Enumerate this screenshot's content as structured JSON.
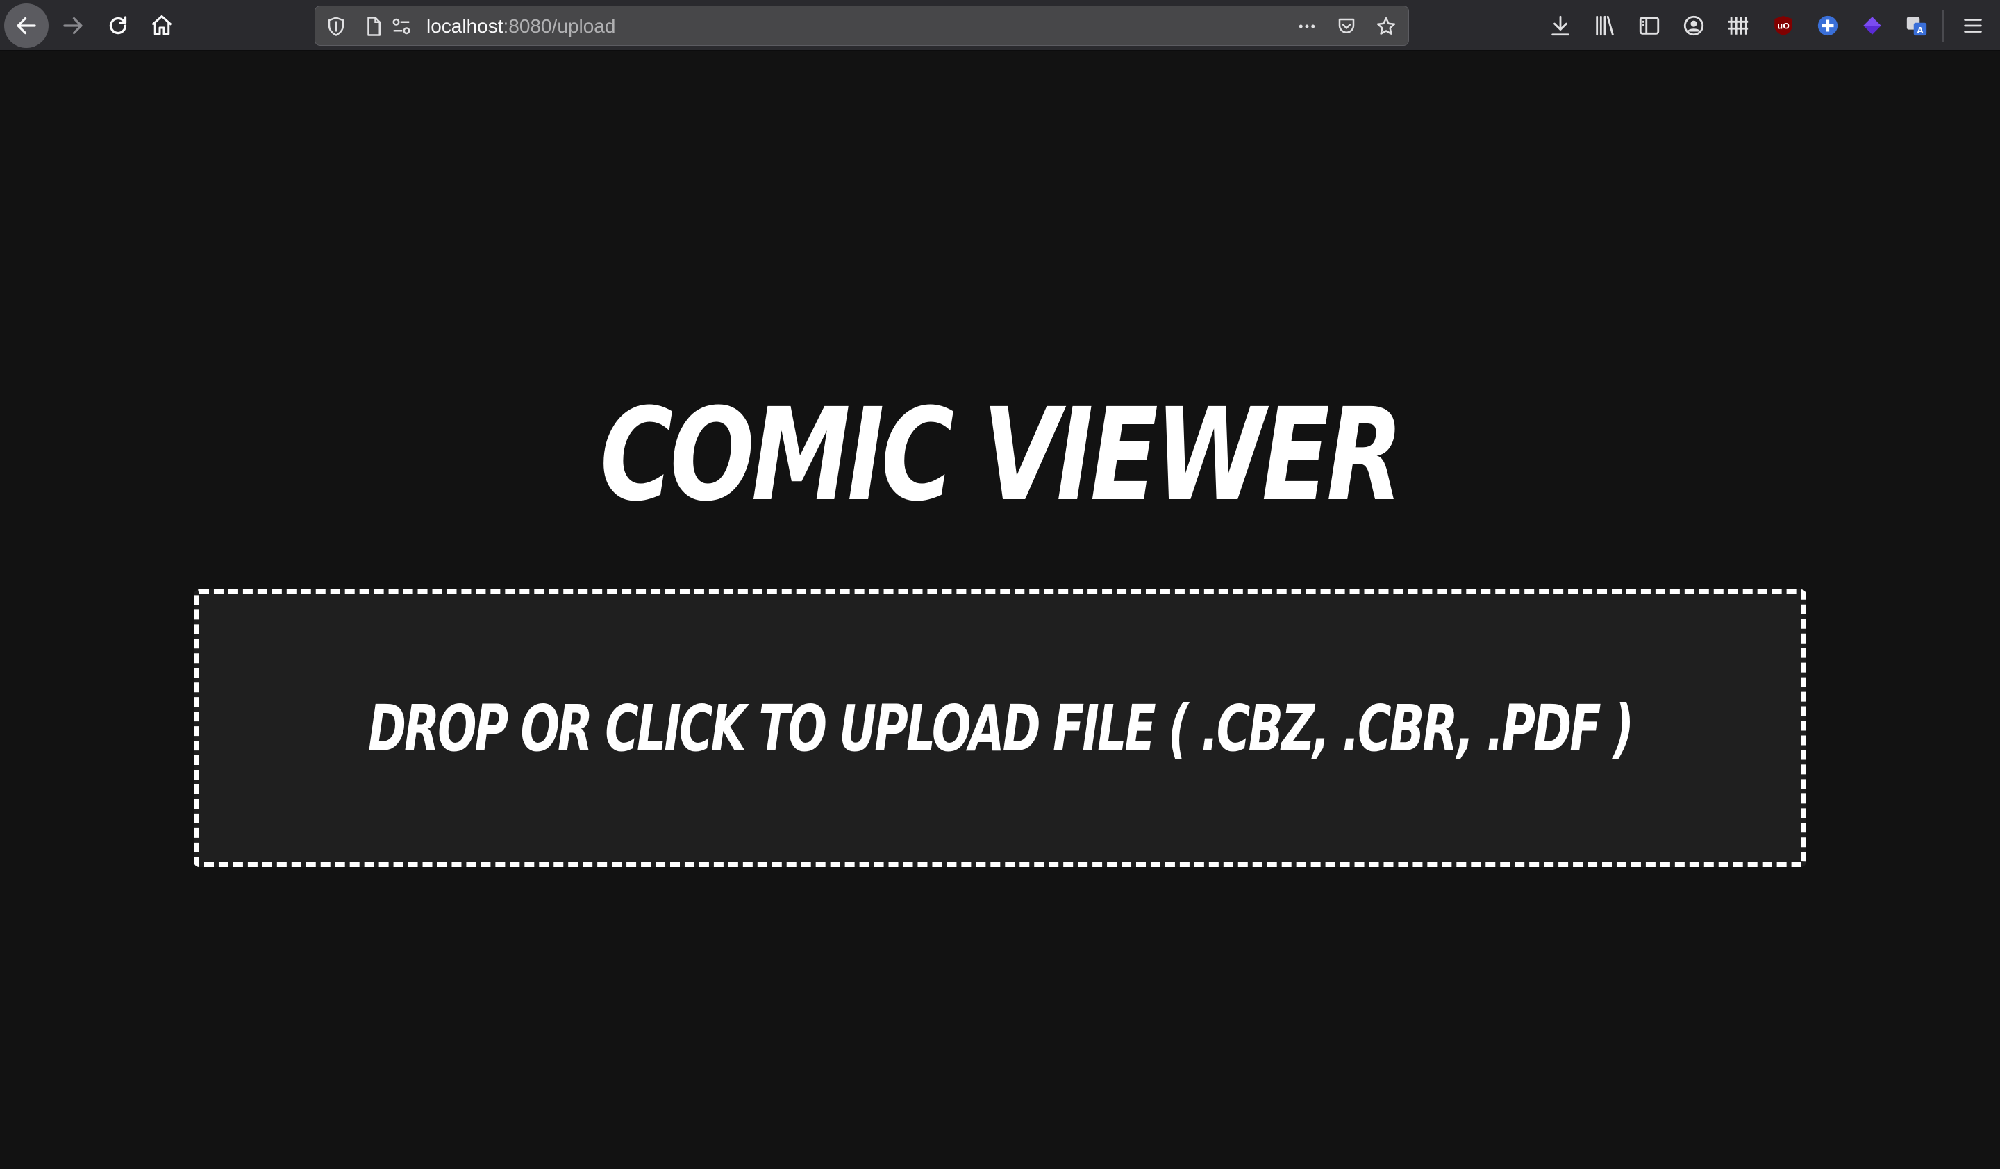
{
  "browser": {
    "url_host": "localhost",
    "url_path": ":8080/upload",
    "nav": {
      "back_icon": "arrow-left-icon",
      "forward_icon": "arrow-right-icon",
      "reload_icon": "reload-icon",
      "home_icon": "home-icon"
    },
    "url_icons": [
      "shield-icon",
      "page-icon",
      "permissions-icon"
    ],
    "url_actions": [
      "more-icon",
      "pocket-icon",
      "bookmark-star-icon"
    ],
    "toolbar_icons": [
      "download-icon",
      "library-icon",
      "sidebar-icon",
      "account-icon",
      "extension-grid-icon",
      "ublock-icon",
      "extension-plus-icon",
      "extension-cube-icon",
      "translate-icon",
      "menu-icon"
    ],
    "colors": {
      "toolbar_bg": "#2a2a2e",
      "urlbar_bg": "#474749",
      "ublock": "#800000",
      "accent_blue": "#3a6fd8",
      "cube_purple": "#5b2bd6"
    }
  },
  "app": {
    "title": "COMIC VIEWER",
    "dropzone_label": "DROP OR CLICK TO UPLOAD FILE ( .CBZ, .CBR, .PDF )",
    "colors": {
      "background": "#121212",
      "dropzone_bg": "#1f1f1f",
      "text": "#ffffff"
    }
  }
}
